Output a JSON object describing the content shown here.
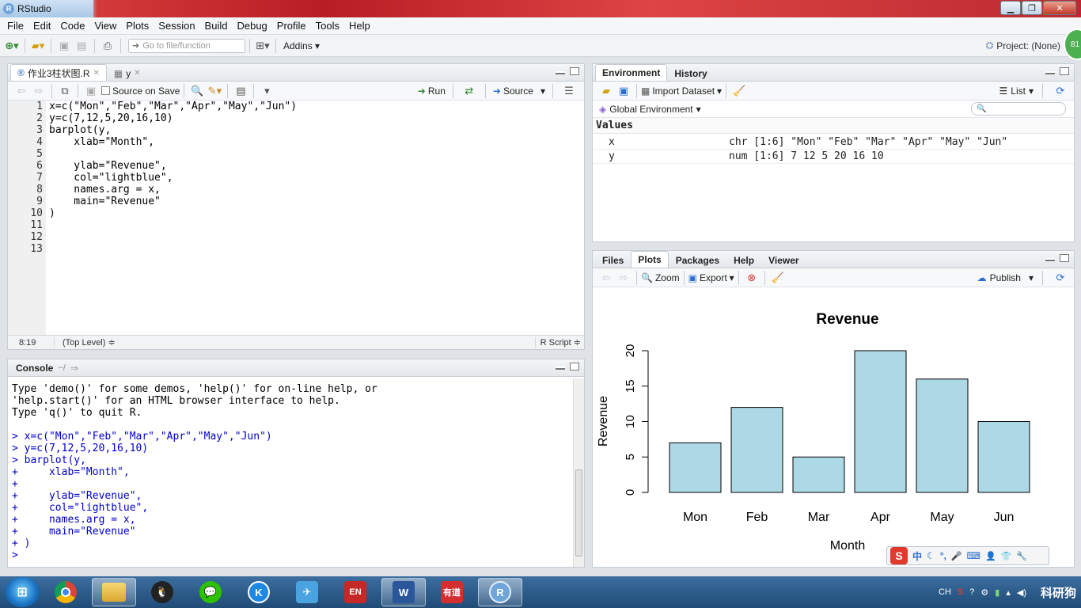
{
  "window": {
    "title": "RStudio"
  },
  "menu": [
    "File",
    "Edit",
    "Code",
    "View",
    "Plots",
    "Session",
    "Build",
    "Debug",
    "Profile",
    "Tools",
    "Help"
  ],
  "toolbar": {
    "goto_placeholder": "Go to file/function",
    "addins": "Addins",
    "project": "Project: (None)",
    "badge": "81"
  },
  "editor": {
    "tabs": [
      {
        "label": "作业3柱状图.R"
      },
      {
        "label": "y"
      }
    ],
    "source_on_save": "Source on Save",
    "run": "Run",
    "source": "Source",
    "lines": [
      "x=c(\"Mon\",\"Feb\",\"Mar\",\"Apr\",\"May\",\"Jun\")",
      "y=c(7,12,5,20,16,10)",
      "barplot(y,",
      "    xlab=\"Month\",",
      "",
      "    ylab=\"Revenue\",",
      "    col=\"lightblue\",",
      "    names.arg = x,",
      "    main=\"Revenue\"",
      ")",
      "",
      "",
      ""
    ],
    "line_numbers": [
      "1",
      "2",
      "3",
      "4",
      "5",
      "6",
      "7",
      "8",
      "9",
      "10",
      "11",
      "12",
      "13"
    ],
    "status_pos": "8:19",
    "status_scope": "(Top Level) ≑",
    "status_type": "R Script ≑"
  },
  "console": {
    "title": "Console",
    "path": "~/",
    "intro": [
      "Type 'demo()' for some demos, 'help()' for on-line help, or",
      "'help.start()' for an HTML browser interface to help.",
      "Type 'q()' to quit R."
    ],
    "commands": [
      "> x=c(\"Mon\",\"Feb\",\"Mar\",\"Apr\",\"May\",\"Jun\")",
      "> y=c(7,12,5,20,16,10)",
      "> barplot(y,",
      "+     xlab=\"Month\",",
      "+",
      "+     ylab=\"Revenue\",",
      "+     col=\"lightblue\",",
      "+     names.arg = x,",
      "+     main=\"Revenue\"",
      "+ )",
      "> "
    ]
  },
  "environment": {
    "tabs": [
      "Environment",
      "History"
    ],
    "import": "Import Dataset",
    "list": "List",
    "global": "Global Environment",
    "section": "Values",
    "rows": [
      {
        "name": "x",
        "value": "chr [1:6] \"Mon\" \"Feb\" \"Mar\" \"Apr\" \"May\" \"Jun\""
      },
      {
        "name": "y",
        "value": "num [1:6] 7 12 5 20 16 10"
      }
    ]
  },
  "plots": {
    "tabs": [
      "Files",
      "Plots",
      "Packages",
      "Help",
      "Viewer"
    ],
    "zoom": "Zoom",
    "export": "Export",
    "publish": "Publish"
  },
  "chart_data": {
    "type": "bar",
    "title": "Revenue",
    "xlabel": "Month",
    "ylabel": "Revenue",
    "categories": [
      "Mon",
      "Feb",
      "Mar",
      "Apr",
      "May",
      "Jun"
    ],
    "values": [
      7,
      12,
      5,
      20,
      16,
      10
    ],
    "yticks": [
      "0",
      "5",
      "10",
      "15",
      "20"
    ],
    "ylim": [
      0,
      20
    ],
    "bar_color": "#add8e6",
    "grid": false
  },
  "ime": {
    "items": [
      "中",
      "☾",
      "°,",
      "🎤",
      "⌨",
      "👤",
      "👕",
      "🔧"
    ]
  },
  "tray": {
    "lang": "CH"
  },
  "watermark": "科研狗"
}
